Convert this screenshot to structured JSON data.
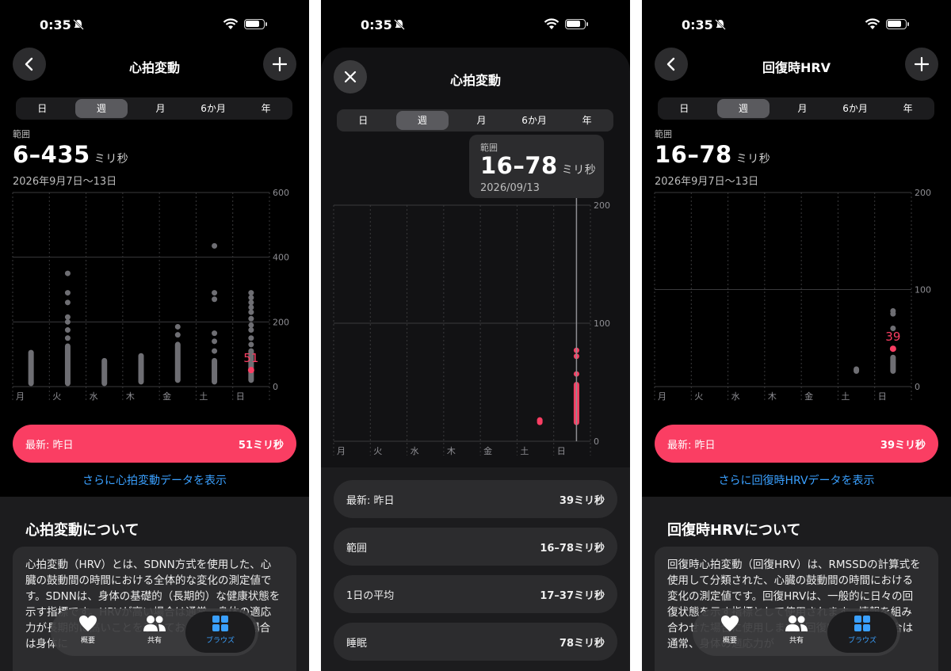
{
  "status": {
    "time": "0:35"
  },
  "colors": {
    "accent": "#fa3e63",
    "link": "#3aa0ff"
  },
  "tabs_segment": [
    "日",
    "週",
    "月",
    "6か月",
    "年"
  ],
  "tabbar": {
    "items": [
      "概要",
      "共有",
      "ブラウズ"
    ],
    "active": "ブラウズ"
  },
  "screen1": {
    "title": "心拍変動",
    "range_label": "範囲",
    "range_value": "6–435",
    "range_unit": "ミリ秒",
    "date": "2026年9月7日〜13日",
    "chart_data": {
      "type": "scatter",
      "categories": [
        "月",
        "火",
        "水",
        "木",
        "金",
        "土",
        "日"
      ],
      "y_ticks": [
        "600",
        "400",
        "200",
        "0"
      ],
      "ylim": [
        0,
        600
      ],
      "highlight_label": "51",
      "highlight_value": 51,
      "series": [
        {
          "category": "月",
          "range": [
            10,
            105
          ],
          "points": []
        },
        {
          "category": "火",
          "range": [
            10,
            125
          ],
          "points": [
            150,
            175,
            200,
            215,
            260,
            290,
            350
          ]
        },
        {
          "category": "水",
          "range": [
            10,
            80
          ],
          "points": []
        },
        {
          "category": "木",
          "range": [
            15,
            95
          ],
          "points": []
        },
        {
          "category": "金",
          "range": [
            20,
            130
          ],
          "points": [
            160,
            185
          ]
        },
        {
          "category": "土",
          "range": [
            15,
            80
          ],
          "points": [
            110,
            140,
            165,
            270,
            290,
            435
          ]
        },
        {
          "category": "日",
          "range": [
            20,
            110
          ],
          "points": [
            130,
            150,
            175,
            190,
            210,
            230,
            245,
            260,
            275,
            290
          ]
        }
      ]
    },
    "latest_label": "最新: 昨日",
    "latest_value": "51ミリ秒",
    "more_link": "さらに心拍変動データを表示",
    "about_title": "心拍変動について",
    "about_text": "心拍変動（HRV）とは、SDNN方式を使用した、心臓の鼓動間の時間における全体的な変化の測定値です。SDNNは、身体の基礎的（長期的）な健康状態を示す指標です。HRVが高い場合は通常、身体の適応力が長期的に高いことを示しており、値が低い場合は身体に"
  },
  "screen2": {
    "title": "心拍変動",
    "tooltip_label": "範囲",
    "tooltip_value": "16–78",
    "tooltip_unit": "ミリ秒",
    "tooltip_date": "2026/09/13",
    "chart_data": {
      "type": "scatter",
      "categories": [
        "月",
        "火",
        "水",
        "木",
        "金",
        "土",
        "日"
      ],
      "y_ticks": [
        "200",
        "100",
        "0"
      ],
      "ylim": [
        0,
        200
      ],
      "series": [
        {
          "category": "土",
          "range": [
            16,
            18
          ],
          "points": []
        },
        {
          "category": "日",
          "range": [
            16,
            48
          ],
          "points": [
            57,
            72,
            77
          ]
        }
      ]
    },
    "rows": [
      {
        "label": "最新: 昨日",
        "value": "39ミリ秒"
      },
      {
        "label": "範囲",
        "value": "16–78ミリ秒"
      },
      {
        "label": "1日の平均",
        "value": "17–37ミリ秒"
      },
      {
        "label": "睡眠",
        "value": "78ミリ秒"
      }
    ]
  },
  "screen3": {
    "title": "回復時HRV",
    "range_label": "範囲",
    "range_value": "16–78",
    "range_unit": "ミリ秒",
    "date": "2026年9月7日〜13日",
    "chart_data": {
      "type": "scatter",
      "categories": [
        "月",
        "火",
        "水",
        "木",
        "金",
        "土",
        "日"
      ],
      "y_ticks": [
        "200",
        "100",
        "0"
      ],
      "ylim": [
        0,
        200
      ],
      "highlight_label": "39",
      "highlight_value": 39,
      "series": [
        {
          "category": "土",
          "range": [
            16,
            18
          ],
          "points": []
        },
        {
          "category": "日",
          "range": [
            16,
            30
          ],
          "points": [
            60,
            75,
            78
          ]
        }
      ]
    },
    "latest_label": "最新: 昨日",
    "latest_value": "39ミリ秒",
    "more_link": "さらに回復時HRVデータを表示",
    "about_title": "回復時HRVについて",
    "about_text": "回復時心拍変動（回復HRV）は、RMSSDの計算式を使用して分類された、心臓の鼓動間の時間における変化の測定値です。回復HRVは、一般的に日々の回復状態を示す指標として使用されます。情報を組み合わせた場合に使用します。回復HRVが高い場合は通常、身体の適応力が"
  }
}
